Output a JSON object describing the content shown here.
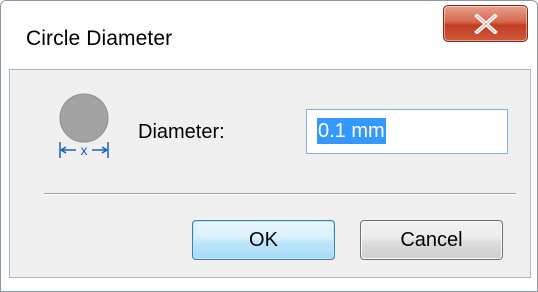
{
  "window": {
    "title": "Circle Diameter",
    "close_icon": "close-x-icon"
  },
  "form": {
    "icon": "circle-diameter-icon",
    "icon_caption": "x",
    "diameter_label": "Diameter:",
    "diameter_value": "0.1 mm",
    "diameter_value_selected": true
  },
  "buttons": {
    "ok_label": "OK",
    "cancel_label": "Cancel"
  },
  "colors": {
    "close_button": "#c94a2e",
    "selection": "#3399ff",
    "ok_border": "#3c7fb1"
  }
}
